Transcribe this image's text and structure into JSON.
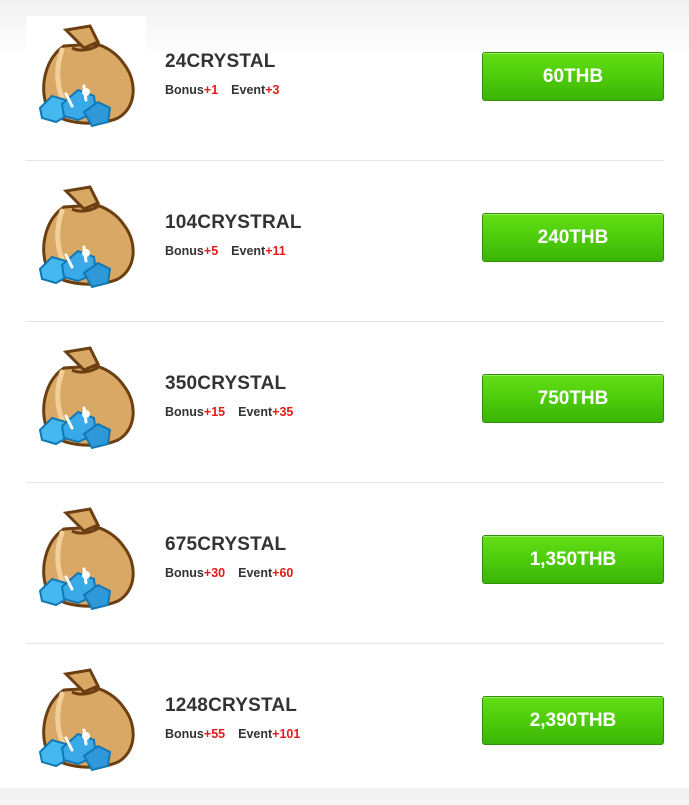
{
  "packages": [
    {
      "name": "24CRYSTAL",
      "bonus_label": "Bonus",
      "bonus_value": "+1",
      "event_label": "Event",
      "event_value": "+3",
      "price": "60THB"
    },
    {
      "name": "104CRYSTRAL",
      "bonus_label": "Bonus",
      "bonus_value": "+5",
      "event_label": "Event",
      "event_value": "+11",
      "price": "240THB"
    },
    {
      "name": "350CRYSTAL",
      "bonus_label": "Bonus",
      "bonus_value": "+15",
      "event_label": "Event",
      "event_value": "+35",
      "price": "750THB"
    },
    {
      "name": "675CRYSTAL",
      "bonus_label": "Bonus",
      "bonus_value": "+30",
      "event_label": "Event",
      "event_value": "+60",
      "price": "1,350THB"
    },
    {
      "name": "1248CRYSTAL",
      "bonus_label": "Bonus",
      "bonus_value": "+55",
      "event_label": "Event",
      "event_value": "+101",
      "price": "2,390THB"
    }
  ],
  "icon": "crystal-bag-icon",
  "colors": {
    "button_green": "#4ecc0b",
    "bonus_red": "#e21a1a",
    "text_dark": "#333333"
  }
}
